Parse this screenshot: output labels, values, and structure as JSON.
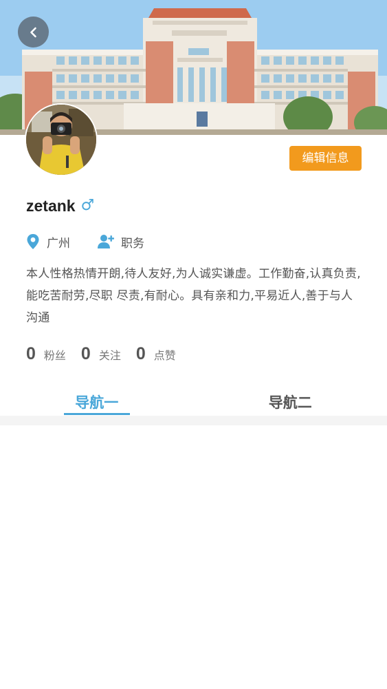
{
  "profile": {
    "username": "zetank",
    "gender_symbol": "♂",
    "location": "广州",
    "position": "职务",
    "bio": "本人性格热情开朗,待人友好,为人诚实谦虚。工作勤奋,认真负责,能吃苦耐劳,尽职 尽责,有耐心。具有亲和力,平易近人,善于与人沟通",
    "edit_label": "编辑信息"
  },
  "stats": [
    {
      "value": "0",
      "label": "粉丝"
    },
    {
      "value": "0",
      "label": "关注"
    },
    {
      "value": "0",
      "label": "点赞"
    }
  ],
  "tabs": [
    {
      "label": "导航一",
      "active": true
    },
    {
      "label": "导航二",
      "active": false
    }
  ],
  "colors": {
    "accent": "#4aa7d9",
    "edit_button": "#f29a1d",
    "text": "#555555"
  },
  "icons": {
    "back": "chevron-left-icon",
    "location": "map-pin-icon",
    "position": "user-plus-icon",
    "gender": "male-icon"
  }
}
